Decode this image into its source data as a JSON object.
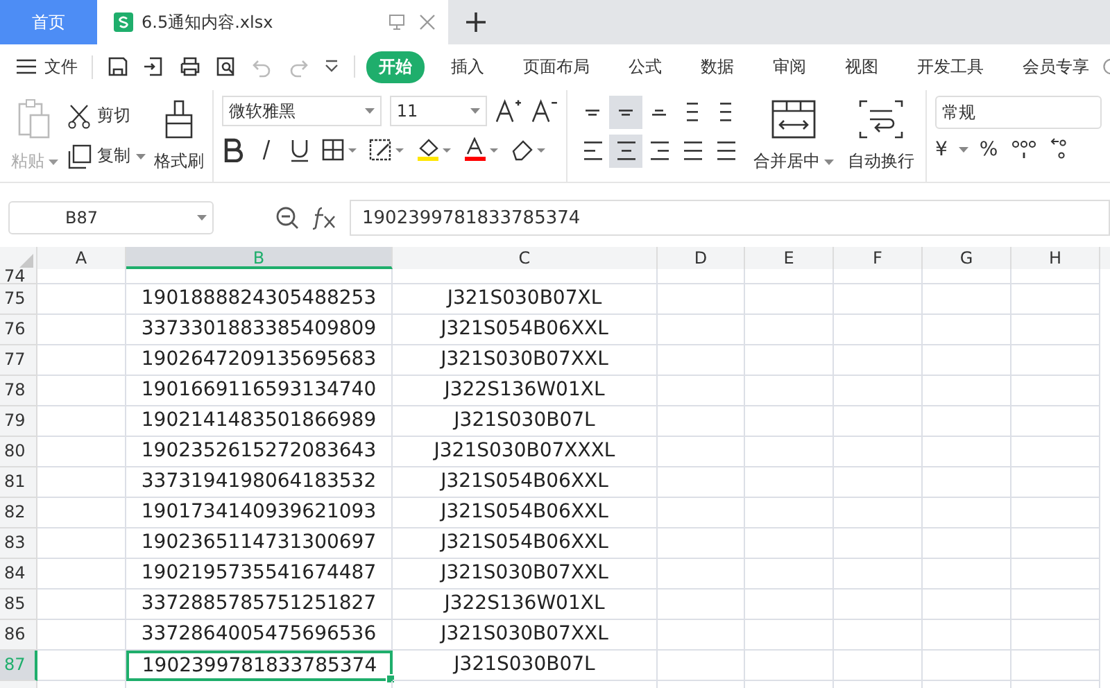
{
  "tabs": [
    {
      "label": "首页",
      "kind": "home",
      "selected": false
    },
    {
      "label": "6.5通知内容.xlsx",
      "kind": "file",
      "selected": true
    }
  ],
  "menu": {
    "file": "文件",
    "items": [
      {
        "label": "开始",
        "selected": true
      },
      {
        "label": "插入",
        "selected": false
      },
      {
        "label": "页面布局",
        "selected": false
      },
      {
        "label": "公式",
        "selected": false
      },
      {
        "label": "数据",
        "selected": false
      },
      {
        "label": "审阅",
        "selected": false
      },
      {
        "label": "视图",
        "selected": false
      },
      {
        "label": "开发工具",
        "selected": false
      },
      {
        "label": "会员专享",
        "selected": false
      }
    ]
  },
  "ribbon": {
    "paste": "粘贴",
    "cut": "剪切",
    "copy": "复制",
    "format_painter": "格式刷",
    "font_name": "微软雅黑",
    "font_size": "11",
    "align_top": [
      {
        "kind": "top",
        "selected": false
      },
      {
        "kind": "middle",
        "selected": true
      },
      {
        "kind": "bottom",
        "selected": false
      },
      {
        "kind": "outdent",
        "selected": false
      },
      {
        "kind": "indent",
        "selected": false
      }
    ],
    "align_bottom": [
      {
        "kind": "left",
        "selected": false
      },
      {
        "kind": "center",
        "selected": true
      },
      {
        "kind": "right",
        "selected": false
      },
      {
        "kind": "justify",
        "selected": false
      },
      {
        "kind": "distribute",
        "selected": false
      }
    ],
    "merge": "合并居中",
    "wrap": "自动换行",
    "number_format": "常规",
    "currency": "¥",
    "percent": "%"
  },
  "formula_bar": {
    "cell_ref": "B87",
    "value": "1902399781833785374"
  },
  "sheet": {
    "columns": [
      {
        "label": "A",
        "selected": false
      },
      {
        "label": "B",
        "selected": true
      },
      {
        "label": "C",
        "selected": false
      },
      {
        "label": "D",
        "selected": false
      },
      {
        "label": "E",
        "selected": false
      },
      {
        "label": "F",
        "selected": false
      },
      {
        "label": "G",
        "selected": false
      },
      {
        "label": "H",
        "selected": false
      }
    ],
    "partial_top_row": "74",
    "rows": [
      {
        "number": "75",
        "b": "1901888824305488253",
        "c": "J321S030B07XL",
        "selected": false
      },
      {
        "number": "76",
        "b": "3373301883385409809",
        "c": "J321S054B06XXL",
        "selected": false
      },
      {
        "number": "77",
        "b": "1902647209135695683",
        "c": "J321S030B07XXL",
        "selected": false
      },
      {
        "number": "78",
        "b": "1901669116593134740",
        "c": "J322S136W01XL",
        "selected": false
      },
      {
        "number": "79",
        "b": "1902141483501866989",
        "c": "J321S030B07L",
        "selected": false
      },
      {
        "number": "80",
        "b": "1902352615272083643",
        "c": "J321S030B07XXXL",
        "selected": false
      },
      {
        "number": "81",
        "b": "3373194198064183532",
        "c": "J321S054B06XXL",
        "selected": false
      },
      {
        "number": "82",
        "b": "1901734140939621093",
        "c": "J321S054B06XXL",
        "selected": false
      },
      {
        "number": "83",
        "b": "1902365114731300697",
        "c": "J321S054B06XXL",
        "selected": false
      },
      {
        "number": "84",
        "b": "1902195735541674487",
        "c": "J321S030B07XXL",
        "selected": false
      },
      {
        "number": "85",
        "b": "3372885785751251827",
        "c": "J322S136W01XL",
        "selected": false
      },
      {
        "number": "86",
        "b": "3372864005475696536",
        "c": "J321S030B07XXL",
        "selected": false
      },
      {
        "number": "87",
        "b": "1902399781833785374",
        "c": "J321S030B07L",
        "selected": true
      }
    ]
  }
}
